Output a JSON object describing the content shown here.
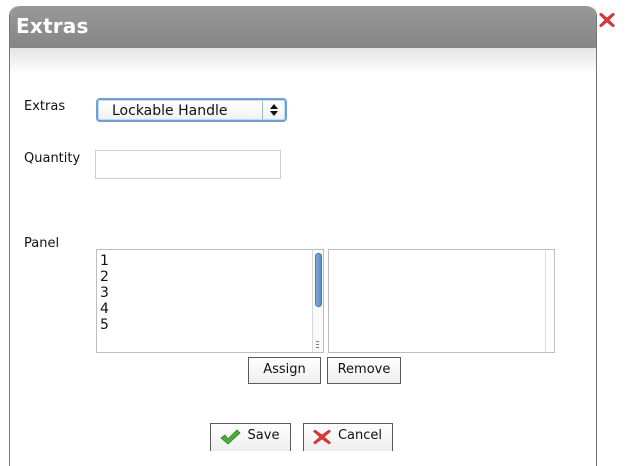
{
  "dialog": {
    "title": "Extras"
  },
  "form": {
    "extras_label": "Extras",
    "extras_selected": "Lockable Handle",
    "quantity_label": "Quantity",
    "quantity_value": "",
    "panel_label": "Panel",
    "panel_items": [
      "1",
      "2",
      "3",
      "4",
      "5"
    ],
    "assigned_items": []
  },
  "buttons": {
    "assign": "Assign",
    "remove": "Remove",
    "save": "Save",
    "cancel": "Cancel"
  },
  "colors": {
    "titlebar": "#8f8f8f",
    "title_text": "#ffffff",
    "close_icon": "#e03a3a",
    "select_focus_border": "#6d9fd6",
    "save_check": "#4caf3a",
    "cancel_x": "#e03a3a"
  },
  "icons": {
    "close": "close-x-icon",
    "save": "checkmark-icon",
    "cancel": "red-x-icon",
    "select_arrows": "up-down-arrows-icon"
  }
}
